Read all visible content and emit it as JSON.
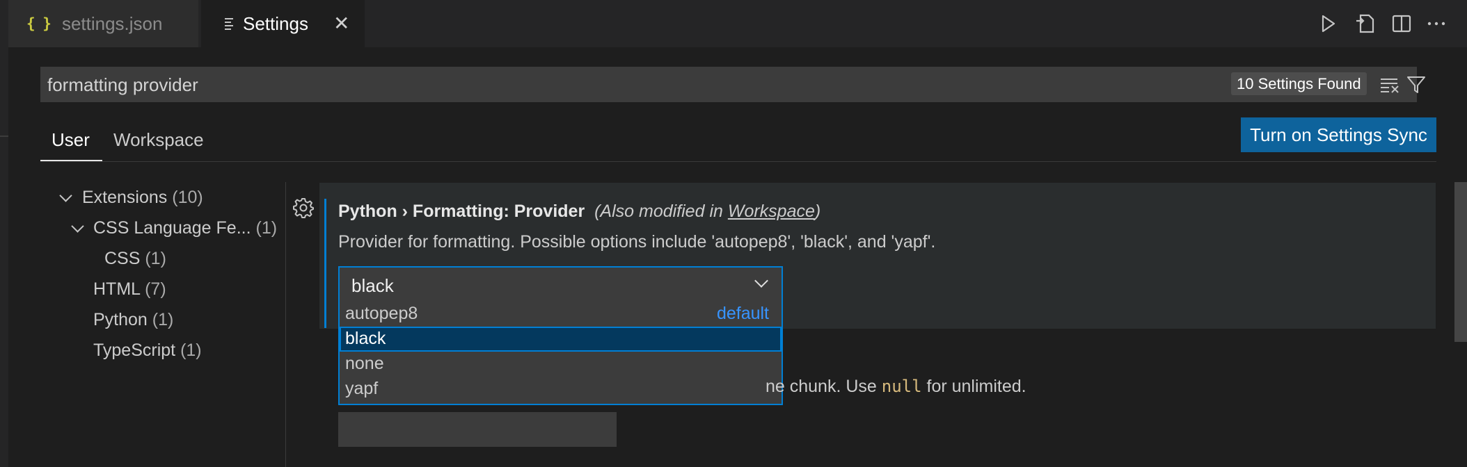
{
  "tabs": [
    {
      "icon": "{ }",
      "label": "settings.json",
      "active": false
    },
    {
      "label": "Settings",
      "active": true
    }
  ],
  "search": {
    "value": "formatting provider",
    "results": "10 Settings Found"
  },
  "scope_tabs": {
    "user": "User",
    "workspace": "Workspace"
  },
  "sync_button": "Turn on Settings Sync",
  "toc": [
    {
      "label": "Extensions",
      "count": "(10)"
    },
    {
      "label": "CSS Language Fe...",
      "count": "(1)"
    },
    {
      "label": "CSS",
      "count": "(1)"
    },
    {
      "label": "HTML",
      "count": "(7)"
    },
    {
      "label": "Python",
      "count": "(1)"
    },
    {
      "label": "TypeScript",
      "count": "(1)"
    }
  ],
  "setting": {
    "category": "Python › Formatting: ",
    "name": "Provider",
    "modified_prefix": "(Also modified in ",
    "modified_link": "Workspace",
    "modified_suffix": ")",
    "description": "Provider for formatting. Possible options include 'autopep8', 'black', and 'yapf'.",
    "value": "black",
    "options": [
      "autopep8",
      "black",
      "none",
      "yapf"
    ],
    "default_label": "default"
  },
  "setting2": {
    "desc_before": "ne chunk. Use ",
    "code": "null",
    "desc_after": " for unlimited."
  },
  "colors": {
    "accent": "#007fd4",
    "sync_button": "#0e639c",
    "link": "#3794ff"
  }
}
